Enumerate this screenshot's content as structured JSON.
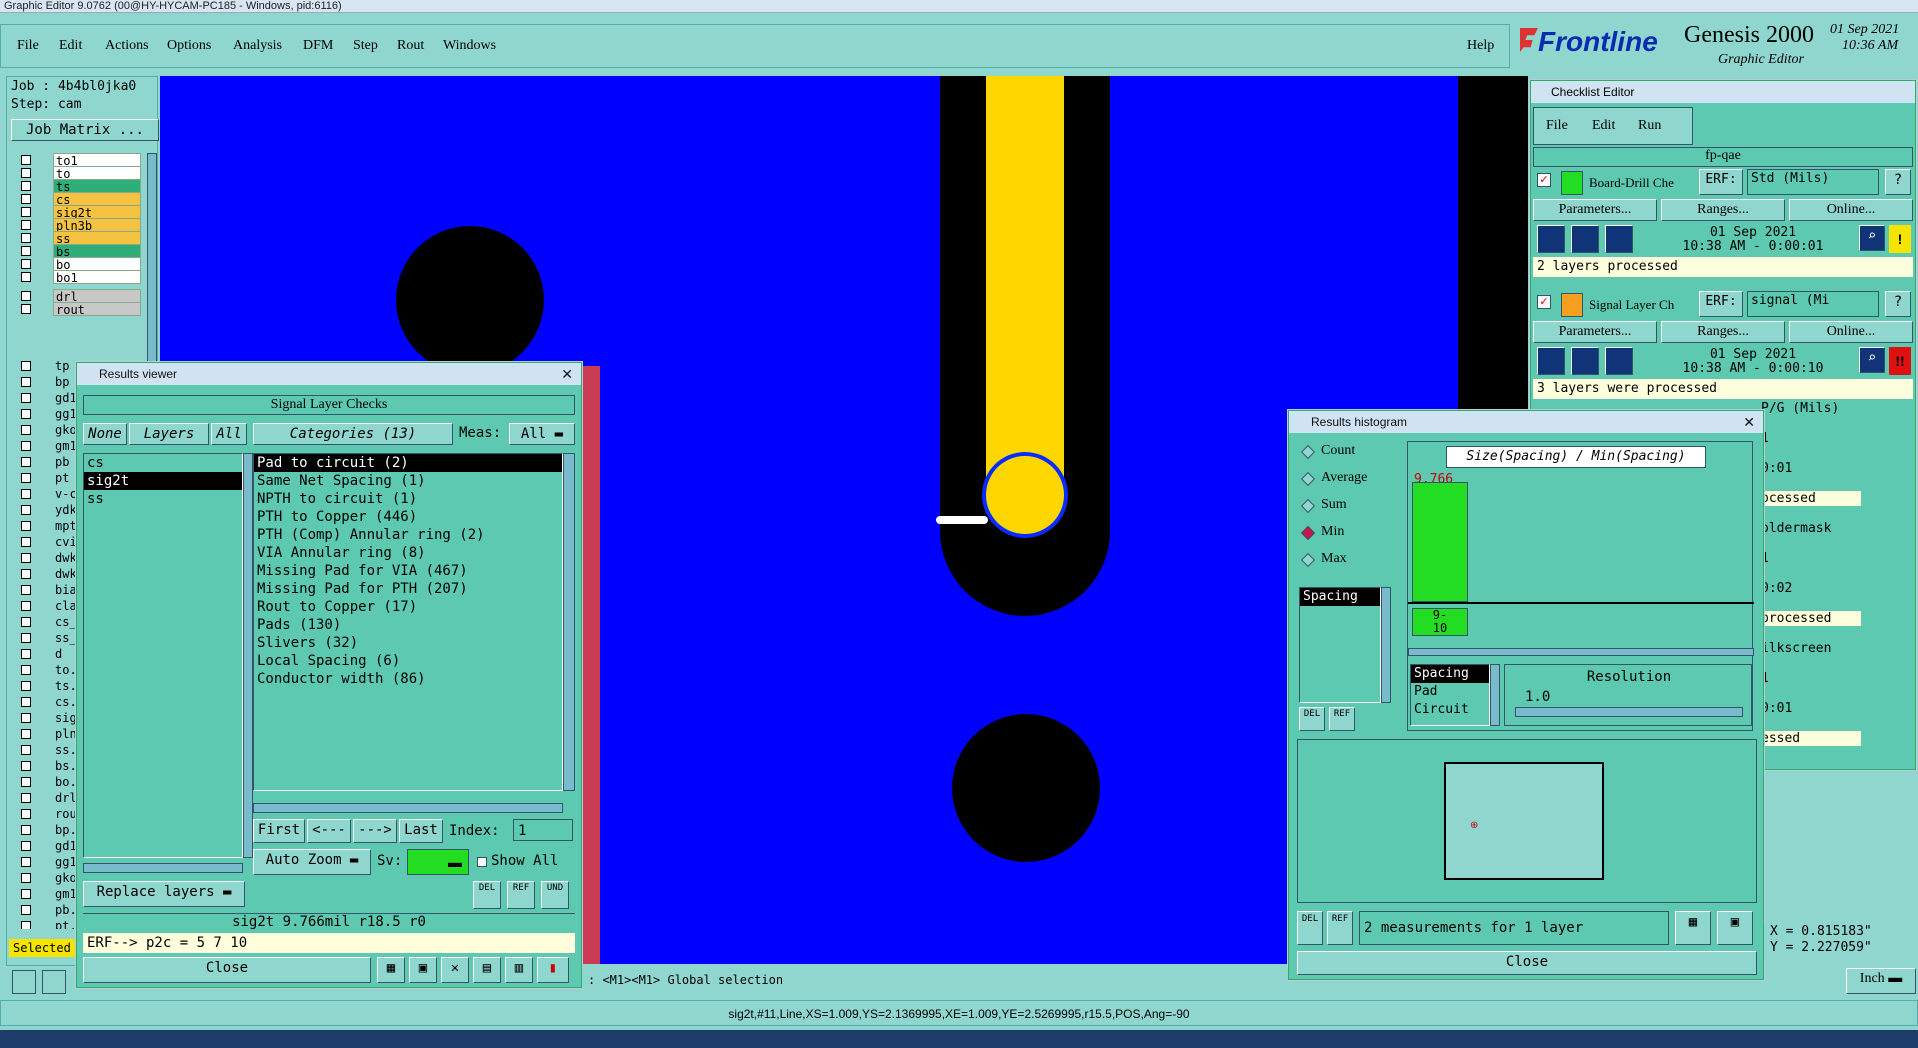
{
  "window_title": "Graphic Editor 9.0762 (00@HY-HYCAM-PC185 - Windows, pid:6116)",
  "menu": [
    "File",
    "Edit",
    "Actions",
    "Options",
    "Analysis",
    "DFM",
    "Step",
    "Rout",
    "Windows"
  ],
  "help": "Help",
  "brand": {
    "logo": "Frontline",
    "product": "Genesis 2000",
    "sub": "Graphic Editor",
    "date": "01 Sep 2021",
    "time": "10:36 AM"
  },
  "job": {
    "job_label": "Job : 4b4bl0jka0",
    "step_label": "Step: cam",
    "matrix_btn": "Job Matrix ..."
  },
  "layers_top": [
    {
      "name": "to1",
      "color": "#ffffff"
    },
    {
      "name": "to",
      "color": "#ffffff"
    },
    {
      "name": "ts",
      "color": "#2fae7a"
    },
    {
      "name": "cs",
      "color": "#f5c242"
    },
    {
      "name": "sig2t",
      "color": "#f5c242"
    },
    {
      "name": "pln3b",
      "color": "#f5c242"
    },
    {
      "name": "ss",
      "color": "#f5c242"
    },
    {
      "name": "bs",
      "color": "#2fae7a"
    },
    {
      "name": "bo",
      "color": "#ffffff"
    },
    {
      "name": "bo1",
      "color": "#ffffff"
    },
    {
      "name": "drl",
      "color": "#c8c8c8"
    },
    {
      "name": "rout",
      "color": "#c8c8c8"
    }
  ],
  "layers_bottom": [
    "tp",
    "bp",
    "gd1",
    "gg1",
    "gko",
    "gm1",
    "pb",
    "pt",
    "v-cu",
    "ydk",
    "mpt",
    "cvia",
    "dwk",
    "dwk",
    "bia",
    "cla",
    "cs_",
    "ss_",
    "d",
    "to.",
    "ts.",
    "cs.",
    "sig",
    "pln",
    "ss.",
    "bs.",
    "bo.",
    "drl",
    "rou",
    "bp.",
    "gd1",
    "gg1",
    "gko",
    "gm1",
    "pb.",
    "pt."
  ],
  "selected_label": "Selected",
  "results_viewer": {
    "title": "Results viewer",
    "header": "Signal Layer Checks",
    "none": "None",
    "layers": "Layers",
    "all": "All",
    "categories_label": "Categories (13)",
    "meas_label": "Meas:",
    "meas_value": "All",
    "layer_list": [
      "cs",
      "sig2t",
      "ss"
    ],
    "categories": [
      "Pad to circuit (2)",
      "Same Net Spacing (1)",
      "NPTH to circuit (1)",
      "PTH to Copper (446)",
      "PTH (Comp) Annular ring (2)",
      "VIA Annular ring (8)",
      "Missing Pad for VIA (467)",
      "Missing Pad for PTH (207)",
      "Rout to Copper (17)",
      "Pads (130)",
      "Slivers (32)",
      "Local Spacing (6)",
      "Conductor width (86)"
    ],
    "first": "First",
    "prev": "<---",
    "next": "--->",
    "last": "Last",
    "index_label": "Index:",
    "index_value": "1",
    "auto_zoom": "Auto Zoom",
    "sv_label": "Sv:",
    "show_all": "Show All",
    "replace_layers": "Replace layers",
    "del": "DEL",
    "ref": "REF",
    "und": "UND",
    "status": "sig2t 9.766mil  r18.5  r0",
    "erf": "ERF--> p2c = 5 7 10",
    "close": "Close"
  },
  "checklist": {
    "title": "Checklist Editor",
    "menu": [
      "File",
      "Edit",
      "Run"
    ],
    "name": "fp-qae",
    "items": [
      {
        "name": "Board-Drill Che",
        "erf": "ERF:",
        "erf_value": "Std (Mils)",
        "date": "01 Sep 2021",
        "time": "10:38 AM - 0:00:01",
        "msg": "2 layers processed",
        "flag": "!",
        "flag_color": "#f5e400"
      },
      {
        "name": "Signal Layer Ch",
        "erf": "ERF:",
        "erf_value": "signal (Mi",
        "date": "01 Sep 2021",
        "time": "10:38 AM - 0:00:10",
        "msg": "3 layers were processed",
        "flag": "!!",
        "flag_color": "#e01010"
      }
    ],
    "params": "Parameters...",
    "ranges": "Ranges...",
    "online": "Online...",
    "partial": [
      "P/G (Mils)",
      "1",
      "0:01",
      "ocessed",
      "oldermask",
      "1",
      "0:02",
      "processed",
      "ilkscreen",
      "1",
      "0:01",
      "essed"
    ]
  },
  "histogram": {
    "title": "Results histogram",
    "options": [
      "Count",
      "Average",
      "Sum",
      "Min",
      "Max"
    ],
    "selected_option": "Min",
    "graph_title": "Size(Spacing) / Min(Spacing)",
    "bar_value": "9.766",
    "bar_fraction": 0.92,
    "bin_label": "9-\n10",
    "left_list": [
      "Spacing"
    ],
    "type_list": [
      "Spacing",
      "Pad",
      "Circuit"
    ],
    "resolution_label": "Resolution",
    "resolution_value": "1.0",
    "del": "DEL",
    "ref": "REF",
    "measurements": "2 measurements for 1 layer",
    "close": "Close"
  },
  "coords": {
    "x": "X = 0.815183\"",
    "y": "Y = 2.227059\""
  },
  "units": "Inch",
  "hint": ": <M1><M1> Global selection",
  "status_line": "sig2t,#11,Line,XS=1.009,YS=2.1369995,XE=1.009,YE=2.5269995,r15.5,POS,Ang=-90",
  "colors": {
    "bg": "#8fd6cf",
    "canvas": "#0000ff",
    "trace": "#ffd700",
    "dialog": "#5cc9b0"
  }
}
